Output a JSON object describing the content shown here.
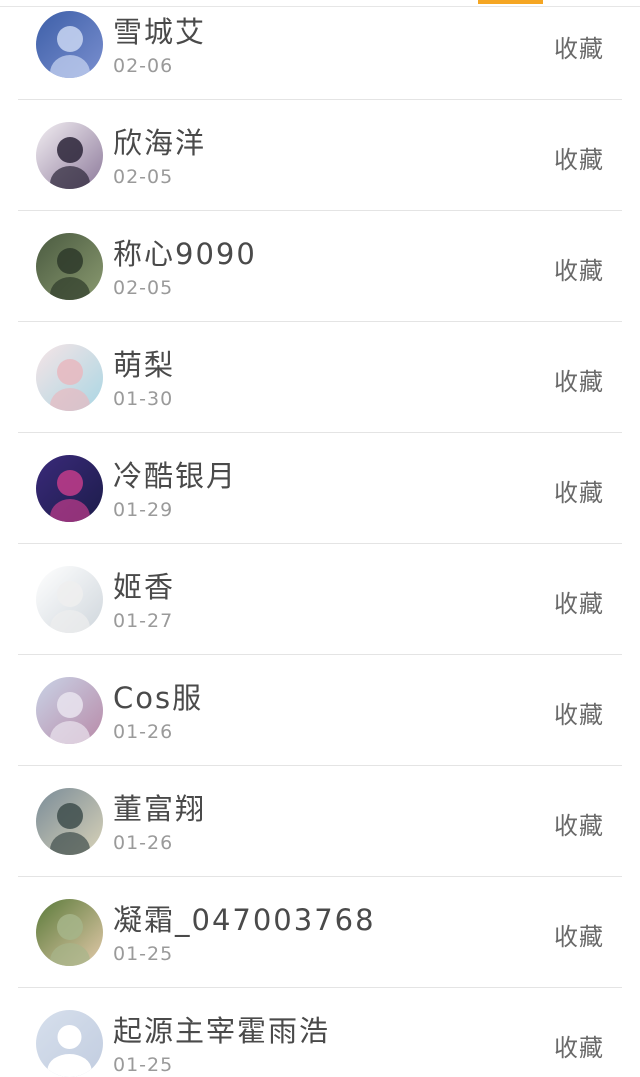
{
  "users": [
    {
      "name": "雪城艾",
      "date": "02-06",
      "action": "收藏",
      "avatar_icon": "avatar-anime-blue",
      "avatar_colors": [
        "#3d5fa8",
        "#c9d6f2",
        "#7a8fcf"
      ]
    },
    {
      "name": "欣海洋",
      "date": "02-05",
      "action": "收藏",
      "avatar_icon": "avatar-anime-dark",
      "avatar_colors": [
        "#f2eef2",
        "#2b2538",
        "#8d7a9b"
      ]
    },
    {
      "name": "称心9090",
      "date": "02-05",
      "action": "收藏",
      "avatar_icon": "avatar-photo-dark",
      "avatar_colors": [
        "#4a5a40",
        "#2e3a2a",
        "#8a9a70"
      ]
    },
    {
      "name": "萌梨",
      "date": "01-30",
      "action": "收藏",
      "avatar_icon": "avatar-anime-pink",
      "avatar_colors": [
        "#f6e4e6",
        "#e8b9c0",
        "#a9d6e3"
      ]
    },
    {
      "name": "冷酷银月",
      "date": "01-29",
      "action": "收藏",
      "avatar_icon": "avatar-anime-purple",
      "avatar_colors": [
        "#3a2a7a",
        "#c23c8a",
        "#1c1c4a"
      ]
    },
    {
      "name": "姬香",
      "date": "01-27",
      "action": "收藏",
      "avatar_icon": "avatar-sketch-white",
      "avatar_colors": [
        "#ffffff",
        "#eeeeee",
        "#cfd6dc"
      ]
    },
    {
      "name": "Cos服",
      "date": "01-26",
      "action": "收藏",
      "avatar_icon": "avatar-photo-pastel",
      "avatar_colors": [
        "#c9d3e6",
        "#e9e4ee",
        "#b88aa8"
      ]
    },
    {
      "name": "董富翔",
      "date": "01-26",
      "action": "收藏",
      "avatar_icon": "avatar-photo-sky",
      "avatar_colors": [
        "#7a8c98",
        "#3e4d4c",
        "#d8d2b8"
      ]
    },
    {
      "name": "凝霜_047003768",
      "date": "01-25",
      "action": "收藏",
      "avatar_icon": "avatar-photo-green",
      "avatar_colors": [
        "#5a7a3a",
        "#a6b58a",
        "#e2c9a9"
      ]
    },
    {
      "name": "起源主宰霍雨浩",
      "date": "01-25",
      "action": "收藏",
      "avatar_icon": "avatar-default-person",
      "avatar_colors": [
        "#d6dfec",
        "#ffffff",
        "#c2cde0"
      ]
    }
  ],
  "accent_color": "#f5a623"
}
